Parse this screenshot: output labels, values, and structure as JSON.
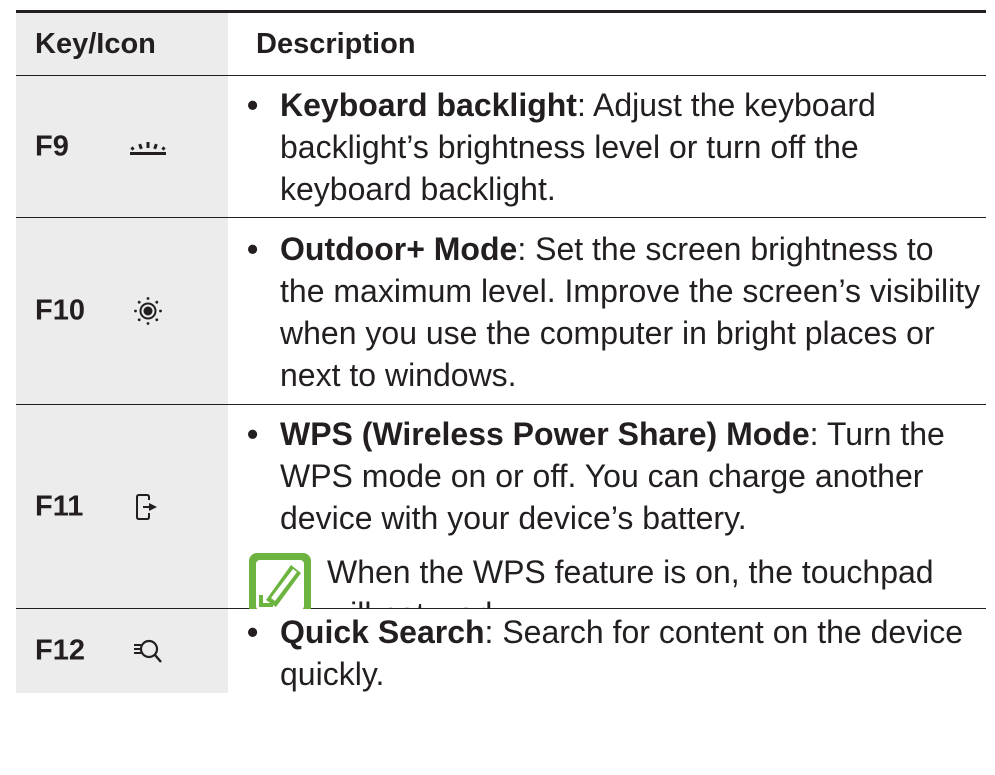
{
  "header": {
    "key_icon": "Key/Icon",
    "description": "Description"
  },
  "rows": [
    {
      "key": "F9",
      "icon": "keyboard-backlight-icon",
      "bullet": "•",
      "title": "Keyboard backlight",
      "text": ": Adjust the keyboard backlight’s brightness level or turn off the keyboard backlight."
    },
    {
      "key": "F10",
      "icon": "outdoor-brightness-icon",
      "bullet": "•",
      "title": "Outdoor+ Mode",
      "text": ": Set the screen brightness to the maximum level. Improve the screen’s visibility when you use the computer in bright places or next to windows."
    },
    {
      "key": "F11",
      "icon": "wireless-power-share-icon",
      "bullet": "•",
      "title": "WPS (Wireless Power Share) Mode",
      "text": ": Turn the WPS mode on or off. You can charge another device with your device’s battery.",
      "note": "When the WPS feature is on, the touchpad will not work.",
      "note_icon": "note-pencil-icon"
    },
    {
      "key": "F12",
      "icon": "quick-search-icon",
      "bullet": "•",
      "title": "Quick Search",
      "text": ": Search for content on the device quickly."
    }
  ],
  "colors": {
    "text": "#231f20",
    "key_column_bg": "#ececec",
    "note_icon_green": "#6cb33f"
  }
}
